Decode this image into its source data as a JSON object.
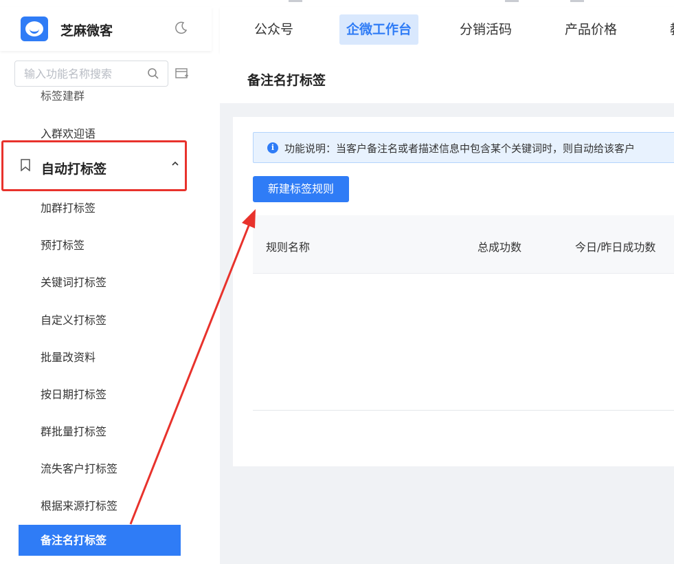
{
  "brand": {
    "name": "芝麻微客"
  },
  "search": {
    "placeholder": "输入功能名称搜索"
  },
  "sidebar": {
    "cut_item": "标签建群",
    "items_before": [
      {
        "label": "入群欢迎语"
      }
    ],
    "group": {
      "label": "自动打标签",
      "expanded": true
    },
    "group_items": [
      {
        "label": "加群打标签"
      },
      {
        "label": "预打标签"
      },
      {
        "label": "关键词打标签"
      },
      {
        "label": "自定义打标签"
      },
      {
        "label": "批量改资料"
      },
      {
        "label": "按日期打标签"
      },
      {
        "label": "群批量打标签"
      },
      {
        "label": "流失客户打标签"
      },
      {
        "label": "根据来源打标签"
      }
    ],
    "active_item": "备注名打标签"
  },
  "topnav": {
    "tabs": [
      {
        "label": "公众号",
        "active": false
      },
      {
        "label": "企微工作台",
        "active": true
      },
      {
        "label": "分销活码",
        "active": false
      },
      {
        "label": "产品价格",
        "active": false
      },
      {
        "label": "教",
        "active": false
      }
    ]
  },
  "page": {
    "title": "备注名打标签",
    "info": "功能说明：当客户备注名或者描述信息中包含某个关键词时，则自动给该客户",
    "new_button": "新建标签规则",
    "table_headers": [
      "规则名称",
      "总成功数",
      "今日/昨日成功数"
    ]
  },
  "colors": {
    "accent": "#2f7cf6",
    "highlight_border": "#e8322c",
    "arrow": "#e8322c"
  }
}
